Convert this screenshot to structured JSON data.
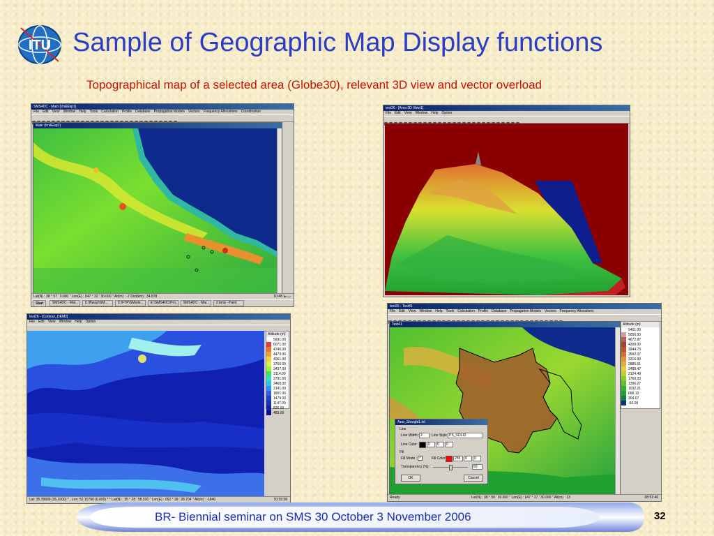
{
  "slide": {
    "title": "Sample of Geographic Map Display functions",
    "subtitle": "Topographical map of a selected area (Globe30), relevant 3D view and vector overload",
    "footer": "BR- Biennial seminar on SMS 30 October 3 November 2006",
    "page_number": "32",
    "logo_text": "ITU",
    "colors": {
      "title": "#2a3dc4",
      "subtitle": "#cc1100",
      "footer": "#1a2bb5"
    }
  },
  "win1": {
    "title": "SMS4DC - Main (Irn&Esp1)",
    "menu": [
      "File",
      "Edit",
      "View",
      "Window",
      "Help",
      "Tools",
      "Calculation",
      "Profile",
      "Database",
      "Propagation Models",
      "Vectors",
      "Frequency Allocations",
      "Coordination"
    ],
    "child_title": "Main (Irn&Esp1)",
    "status": "Lat(N) : 38 ° 57 ' 0.000 \"   Lon(E) : 047 ° 32 ' 30.000 \"   Alt(m) : -7   Dist(km) : 34.878",
    "clock": "10:48 ب.ظ",
    "taskbar_start": "Start",
    "taskbar_items": [
      "SMS4DC - Mai...",
      "C:\\Bwayl\\SM...",
      "C:\\FTP\\SMsde...",
      "E:\\SMS4DC\\Pro...",
      "SMS4DC - Mai...",
      "2.bmp - Paint"
    ]
  },
  "win2": {
    "title": "test26 - [Area 3D View1]",
    "menu": [
      "File",
      "Edit",
      "View",
      "Window",
      "Help",
      "Option"
    ]
  },
  "win3": {
    "title": "test26 - [Contour_DEM2]",
    "menu": [
      "File",
      "Edit",
      "View",
      "Window",
      "Help",
      "Option"
    ],
    "legend_title": "Altitude (m)",
    "legend_values": [
      "5691.00",
      "6071.00",
      "4746.00",
      "4473.00",
      "4061.00",
      "3760.00",
      "3437.00",
      "3114.00",
      "2791.00",
      "2468.00",
      "2141.00",
      "1801.00",
      "1479.00",
      "1147.00",
      "826.00",
      "483.00"
    ],
    "legend_colors": [
      "#ffffff",
      "#e04040",
      "#f07030",
      "#f0a030",
      "#f0d040",
      "#d8f040",
      "#a0f040",
      "#40e060",
      "#30e0c0",
      "#30c0f0",
      "#3090f0",
      "#3060e0",
      "#2040d0",
      "#1830c0",
      "#1020a8",
      "#0a1090"
    ],
    "status": "Lat: 35.39999 (35.2000) * , Lon: 52.15790 (0.000) * *   Lat(N) : 35 ° 28 ' 58.320 \"   Lon(E) : 052 ° 39 ' 28.704 \"   Alt(m) : -1840",
    "clock": "10:32:38"
  },
  "win4": {
    "title": "test26 - Test41",
    "menu": [
      "File",
      "Edit",
      "View",
      "Window",
      "Help",
      "Tools",
      "Calculation",
      "Profile",
      "Database",
      "Propagation Models",
      "Vectors",
      "Frequency Allocations"
    ],
    "child_title": "Test41",
    "legend_title": "Altitude (m)",
    "legend_values": [
      "5401.00",
      "5056.93",
      "4672.97",
      "4300.00",
      "3944.73",
      "3592.07",
      "3216.90",
      "2885.51",
      "2488.47",
      "2124.49",
      "1760.33",
      "1396.27",
      "1032.21",
      "668.13",
      "304.07",
      "-60.00"
    ],
    "legend_colors": [
      "#ffffff",
      "#d0a0a0",
      "#b06060",
      "#a04030",
      "#c05030",
      "#d07030",
      "#e09040",
      "#e0b040",
      "#e0d040",
      "#c0d030",
      "#90c830",
      "#60c030",
      "#30b030",
      "#20a040",
      "#108040",
      "#0a3080"
    ],
    "status_left": "Ready",
    "status": "Lat(N) : 38 ° 58 ' 30.000 \"   Lon(E) : 047 ° 27 ' 30.000 \"   Alt(m) : 13",
    "clock": "08:51:46"
  },
  "dialog": {
    "title": "Azar_Sharghi1.txt",
    "line_group": "Line",
    "line_width_label": "Line Width :",
    "line_width_value": "2",
    "line_style_label": "Line Style :",
    "line_style_value": "PS_SOLID",
    "line_color_label": "Line Color :",
    "line_color_rgb": [
      "0",
      "0",
      "0"
    ],
    "fill_group": "Fill",
    "fill_mode_label": "Fill Mode :",
    "fill_color_label": "Fill Color :",
    "fill_color_rgb": [
      "255",
      "0",
      "0"
    ],
    "transparency_label": "Transparency (%) :",
    "transparency_value": "50",
    "ok_label": "OK",
    "cancel_label": "Cancel"
  }
}
